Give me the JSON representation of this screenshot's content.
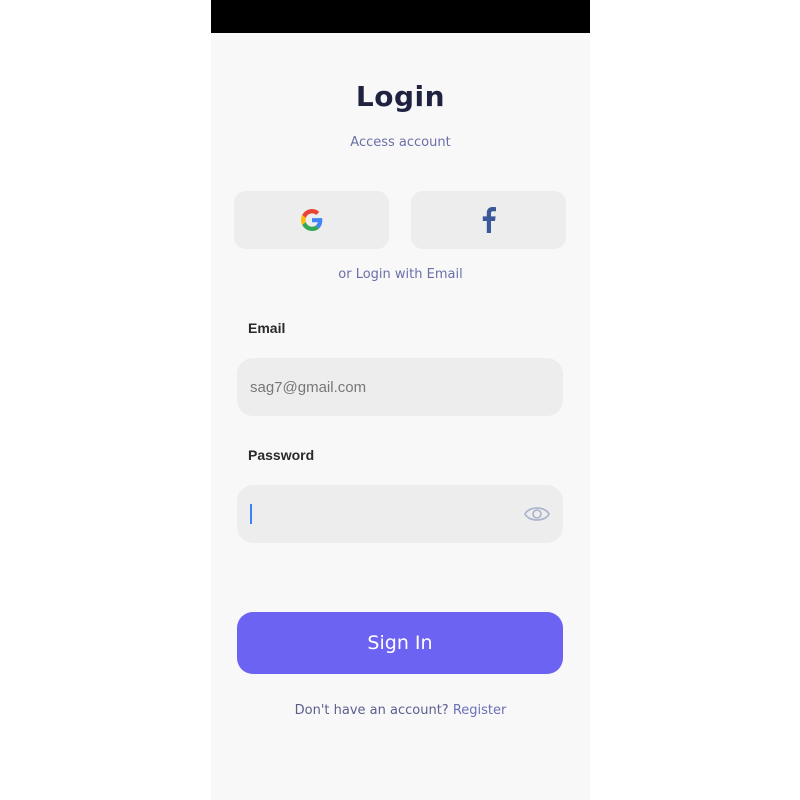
{
  "header": {
    "title": "Login",
    "subtitle": "Access account"
  },
  "social": {
    "google_icon": "google-icon",
    "facebook_icon": "facebook-icon",
    "divider_text": "or Login with Email"
  },
  "form": {
    "email_label": "Email",
    "email_value": "sag7@gmail.com",
    "password_label": "Password",
    "password_value": "",
    "eye_icon": "eye-icon"
  },
  "actions": {
    "signin_label": "Sign In",
    "register_prompt": "Don't have an account?",
    "register_link": "Register"
  },
  "colors": {
    "accent": "#6c63f2",
    "title": "#1f2340",
    "muted": "#6b6fa8",
    "field_bg": "#ededed",
    "background": "#f8f8f8",
    "status_bar": "#000000"
  }
}
